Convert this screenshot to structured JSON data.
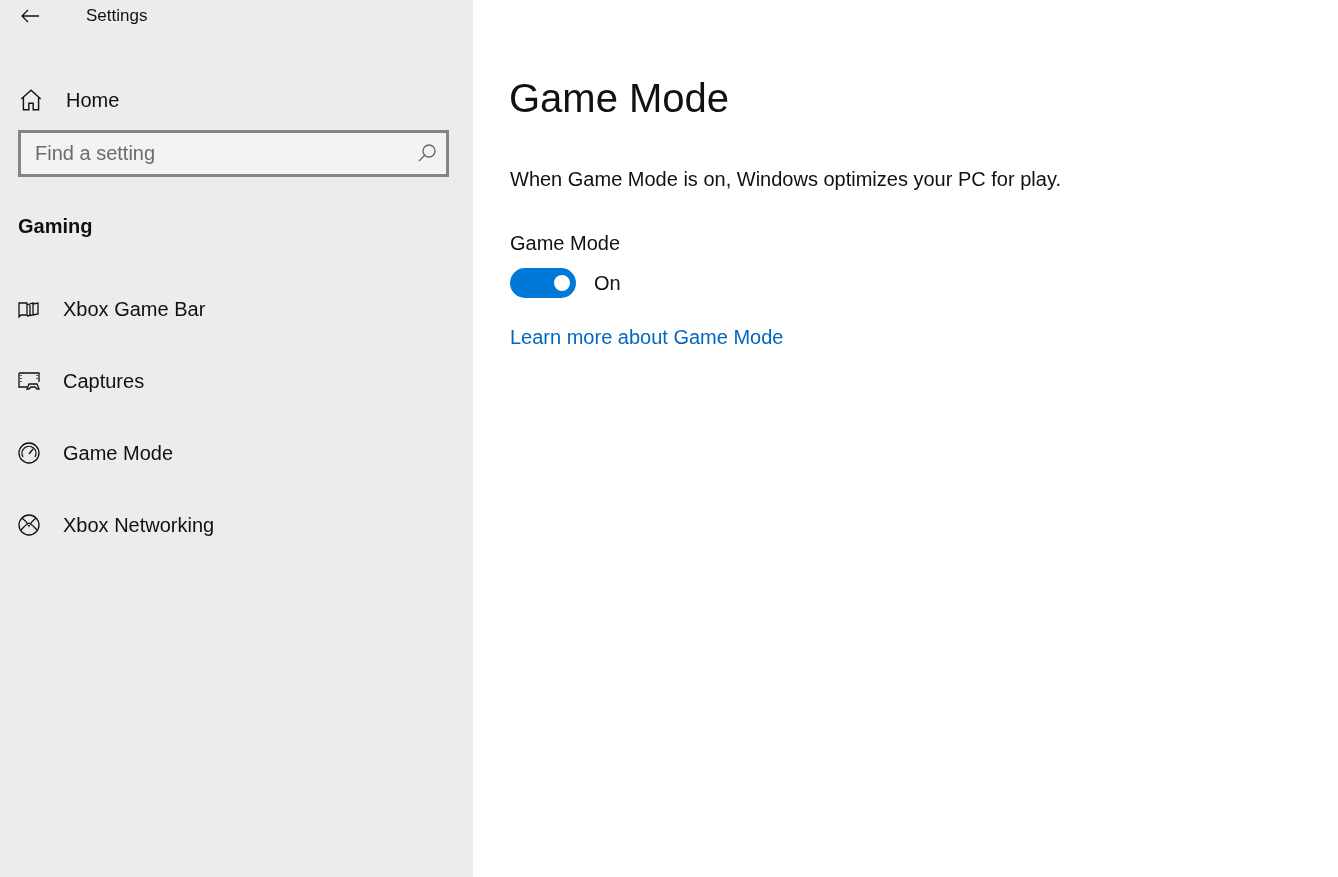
{
  "window": {
    "title": "Settings"
  },
  "sidebar": {
    "home": "Home",
    "search": {
      "placeholder": "Find a setting"
    },
    "section": "Gaming",
    "items": [
      {
        "label": "Xbox Game Bar",
        "kind": "gamebar"
      },
      {
        "label": "Captures",
        "kind": "captures"
      },
      {
        "label": "Game Mode",
        "kind": "gamemode"
      },
      {
        "label": "Xbox Networking",
        "kind": "networking"
      }
    ]
  },
  "page": {
    "title": "Game Mode",
    "description": "When Game Mode is on, Windows optimizes your PC for play.",
    "toggle": {
      "label": "Game Mode",
      "on": true,
      "state_text": "On"
    },
    "link": "Learn more about Game Mode"
  }
}
